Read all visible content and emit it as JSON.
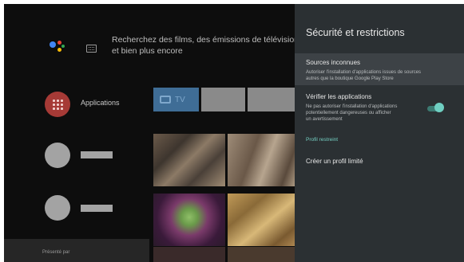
{
  "search": {
    "line1": "Recherchez des films, des émissions de télévision",
    "line2": "et bien plus encore",
    "assistant_colors": [
      "#4285f4",
      "#ea4335",
      "#fbbc05",
      "#34a853"
    ]
  },
  "apps_row": {
    "label": "Applications",
    "accent": "#a63a36",
    "tiles": [
      {
        "label": "TV",
        "color": "#3f6d96"
      },
      {
        "label": "",
        "color": "#8a8a8a"
      },
      {
        "label": "",
        "color": "#8a8a8a"
      }
    ]
  },
  "sponsor": {
    "label": "Présenté par"
  },
  "panel": {
    "title": "Sécurité et restrictions",
    "items": [
      {
        "title": "Sources inconnues",
        "description_line1": "Autoriser l'installation d'applications issues de sources",
        "description_line2": "autres que la boutique Google Play Store"
      },
      {
        "title": "Vérifier les applications",
        "description_line1": "Ne pas autoriser l'installation d'applications",
        "description_line2": "potentiellement dangereuses ou afficher",
        "description_line3": "un avertissement",
        "toggle_on": true
      }
    ],
    "section_label": "Profil restreint",
    "create_profile": "Créer un profil limité",
    "accent": "#74cfc2"
  }
}
